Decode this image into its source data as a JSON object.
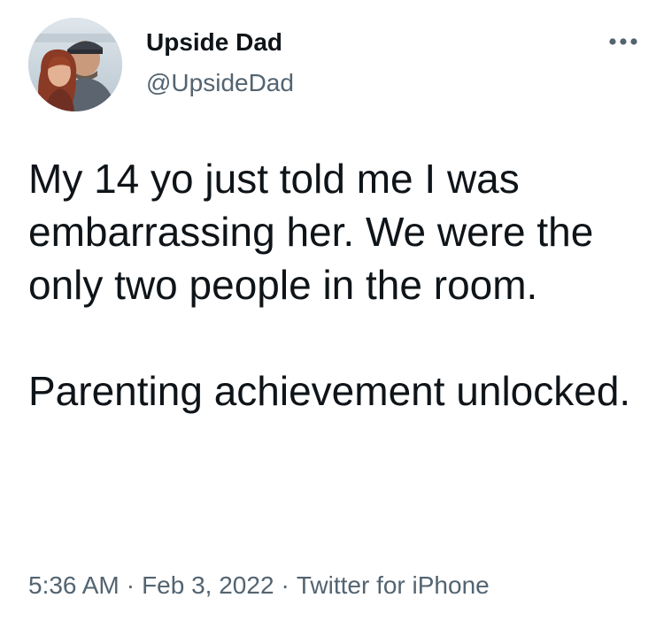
{
  "author": {
    "display_name": "Upside Dad",
    "handle": "@UpsideDad",
    "avatar_icon": "profile-photo"
  },
  "tweet": {
    "paragraphs": [
      "My 14 yo just told me I was embarrassing her. We were the only two people in the room.",
      "Parenting achievement unlocked."
    ]
  },
  "meta": {
    "time": "5:36 AM",
    "separator": "·",
    "date": "Feb 3, 2022",
    "source": "Twitter for iPhone"
  },
  "icons": {
    "more": "more-horizontal-icon"
  },
  "colors": {
    "text_primary": "#0f1419",
    "text_secondary": "#536471",
    "background": "#ffffff"
  }
}
